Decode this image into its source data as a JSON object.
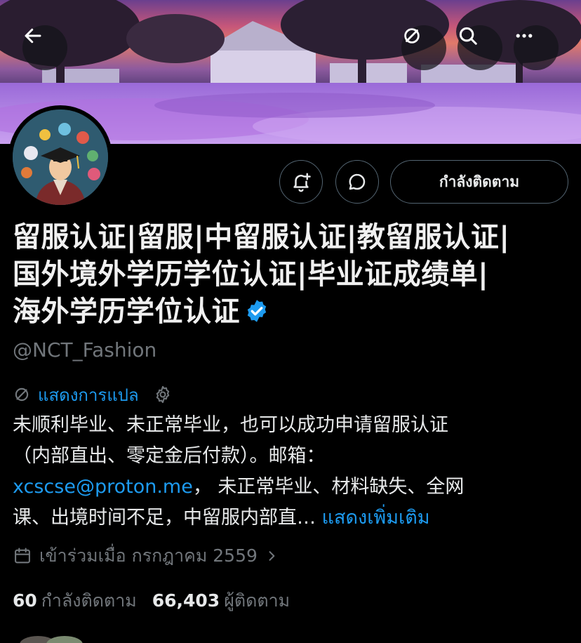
{
  "header": {
    "back_icon": "arrow-left-icon",
    "translate_icon": "translate-off-icon",
    "search_icon": "search-icon",
    "more_icon": "more-horizontal-icon"
  },
  "profile": {
    "display_name_lines": [
      "留服认证|留服|中留服认证|教留服认证|",
      "国外境外学历学位认证|毕业证成绩单|",
      "海外学历学位认证"
    ],
    "verified": true,
    "handle": "@NCT_Fashion",
    "follow_button": "กำลังติดตาม",
    "translate_label": "แสดงการแปล",
    "bio": {
      "line1": "未顺利毕业、未正常毕业，也可以成功申请留服认证",
      "line2": "（内部直出、零定金后付款）。邮箱：",
      "link": "xcscse@proton.me",
      "line3_rest": "，  未正常毕业、材料缺失、全网",
      "line4": "课、出境时间不足，中留服内部直…",
      "show_more": "แสดงเพิ่มเติม"
    },
    "joined": "เข้าร่วมเมื่อ กรกฎาคม 2559",
    "following_count": "60",
    "following_label": "กำลังติดตาม",
    "followers_count": "66,403",
    "followers_label": "ผู้ติดตาม"
  },
  "colors": {
    "accent": "#1d9bf0",
    "muted": "#71767b",
    "background": "#000000"
  }
}
